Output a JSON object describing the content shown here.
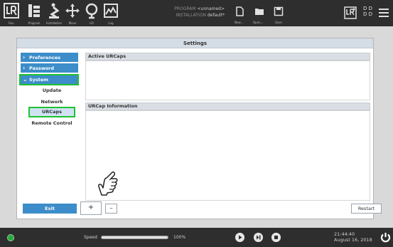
{
  "header": {
    "nav": [
      {
        "label": "Run",
        "icon": "ur-logo-icon"
      },
      {
        "label": "Program",
        "icon": "program-icon"
      },
      {
        "label": "Installation",
        "icon": "installation-icon"
      },
      {
        "label": "Move",
        "icon": "move-icon"
      },
      {
        "label": "I/O",
        "icon": "io-icon"
      },
      {
        "label": "Log",
        "icon": "log-icon"
      }
    ],
    "program_key": "PROGRAM",
    "program_value": "<unnamed>",
    "installation_key": "INSTALLATION",
    "installation_value": "default*",
    "file_actions": [
      {
        "label": "New...",
        "icon": "new-file-icon"
      },
      {
        "label": "Open...",
        "icon": "open-folder-icon"
      },
      {
        "label": "Save",
        "icon": "save-icon"
      }
    ],
    "dd_text": "D D"
  },
  "window": {
    "title": "Settings",
    "nav": {
      "preferences": "Preferences",
      "password": "Password",
      "system": "System"
    },
    "sub": {
      "update": "Update",
      "network": "Network",
      "urcaps": "URCaps",
      "remote_control": "Remote Control"
    },
    "active_urcaps_header": "Active URCaps",
    "urcap_info_header": "URCap Information",
    "exit_label": "Exit",
    "add_label": "+",
    "remove_label": "–",
    "restart_label": "Restart"
  },
  "footer": {
    "speed_label": "Speed",
    "speed_value": "100%",
    "speed_fraction": 1.0,
    "time": "21:44:40",
    "date": "August 16, 2018"
  },
  "colors": {
    "accent": "#3c8dc9",
    "highlight": "#1fc131",
    "header_bg": "#2e2e2e"
  }
}
